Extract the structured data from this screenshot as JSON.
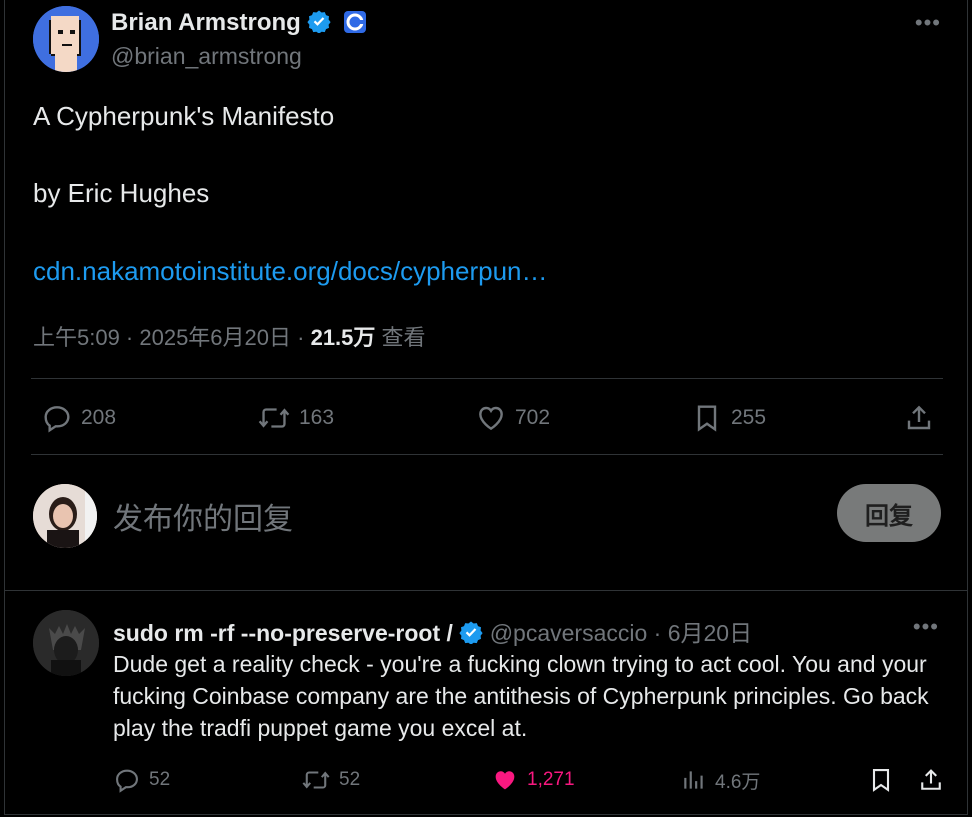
{
  "post": {
    "author_name": "Brian Armstrong",
    "author_handle": "@brian_armstrong",
    "text_title": "A Cypherpunk's Manifesto",
    "text_byline": "by Eric Hughes",
    "link": "cdn.nakamotoinstitute.org/docs/cypherpun…",
    "time": "上午5:09 · 2025年6月20日 · ",
    "views": "21.5万",
    "views_label": " 查看",
    "stats": {
      "replies": "208",
      "reposts": "163",
      "likes": "702",
      "bookmarks": "255"
    }
  },
  "reply_box": {
    "placeholder": "发布你的回复",
    "button_label": "回复"
  },
  "comment": {
    "author_name": "sudo rm -rf --no-preserve-root /",
    "author_handle": "@pcaversaccio",
    "date": " · 6月20日",
    "text": "Dude get a reality check - you're a fucking clown trying to act cool. You and your fucking Coinbase company are the antithesis of Cypherpunk principles. Go back play the tradfi puppet game you excel at.",
    "stats": {
      "replies": "52",
      "reposts": "52",
      "likes": "1,271",
      "views": "4.6万"
    }
  },
  "colors": {
    "background": "#000000",
    "text": "#e7e9ea",
    "muted": "#71767b",
    "link": "#1d9bf0",
    "verified": "#1d9bf0",
    "like_active": "#f91880"
  }
}
